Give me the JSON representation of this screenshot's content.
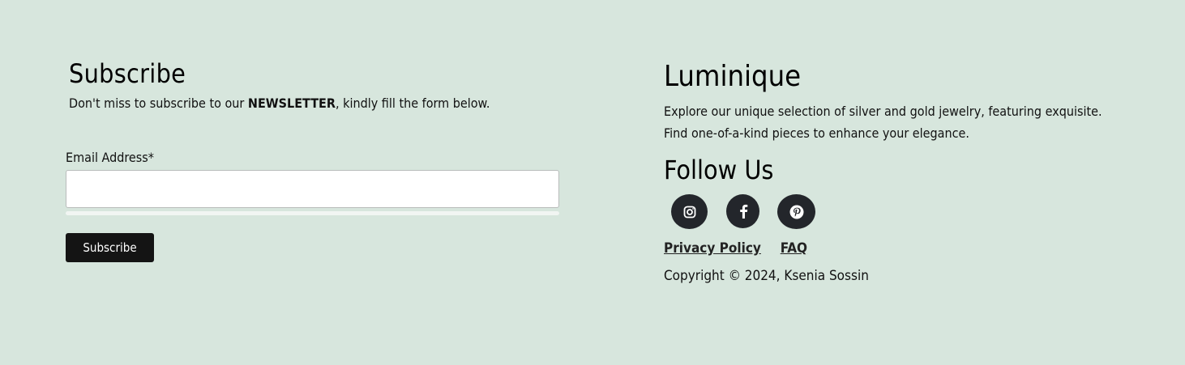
{
  "subscribe": {
    "title": "Subscribe",
    "intro_before": "Don't miss to subscribe to our ",
    "intro_emphasis": "NEWSLETTER",
    "intro_after": ", kindly fill the form below.",
    "email_label": "Email Address*",
    "email_value": "",
    "email_placeholder": "",
    "button_label": "Subscribe"
  },
  "brand": {
    "name": "Luminique",
    "description_line1": "Explore our unique selection of silver and gold jewelry, featuring exquisite.",
    "description_line2": "Find one-of-a-kind pieces to enhance your elegance."
  },
  "social": {
    "title": "Follow Us",
    "icons": [
      "instagram-icon",
      "facebook-icon",
      "pinterest-icon"
    ]
  },
  "links": {
    "privacy": "Privacy Policy",
    "faq": "FAQ"
  },
  "copyright": "Copyright © 2024, Ksenia Sossin",
  "colors": {
    "background": "#d7e6dd",
    "button": "#141414",
    "social_circle": "#23262b"
  }
}
